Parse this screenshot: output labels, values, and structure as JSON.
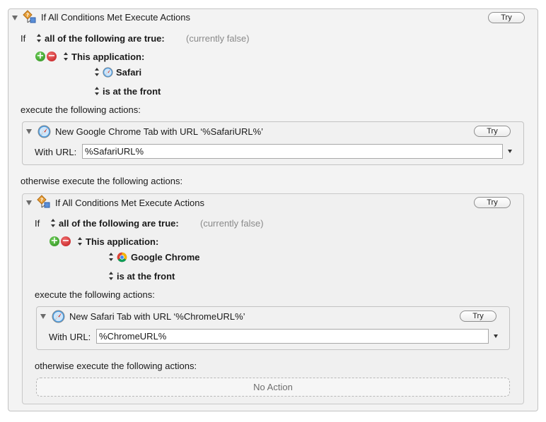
{
  "outer": {
    "title": "If All Conditions Met Execute Actions",
    "try_label": "Try",
    "if_label": "If",
    "condition_mode": "all of the following are true:",
    "condition_state": "(currently false)",
    "condition": {
      "type_label": "This application:",
      "app_name": "Safari",
      "state_label": "is at the front"
    },
    "execute_label": "execute the following actions:",
    "action": {
      "title": "New Google Chrome Tab with URL ‘%SafariURL%’",
      "try_label": "Try",
      "url_label": "With URL:",
      "url_value": "%SafariURL%"
    },
    "otherwise_label": "otherwise execute the following actions:"
  },
  "inner": {
    "title": "If All Conditions Met Execute Actions",
    "try_label": "Try",
    "if_label": "If",
    "condition_mode": "all of the following are true:",
    "condition_state": "(currently false)",
    "condition": {
      "type_label": "This application:",
      "app_name": "Google Chrome",
      "state_label": "is at the front"
    },
    "execute_label": "execute the following actions:",
    "action": {
      "title": "New Safari Tab with URL ‘%ChromeURL%’",
      "try_label": "Try",
      "url_label": "With URL:",
      "url_value": "%ChromeURL%"
    },
    "otherwise_label": "otherwise execute the following actions:",
    "no_action_label": "No Action"
  },
  "icons": {
    "if_action": "if-then-else-icon",
    "safari": "safari-compass-icon",
    "chrome": "google-chrome-icon",
    "plus": "add-condition-icon",
    "minus": "remove-condition-icon"
  },
  "colors": {
    "plus_button": "#2d8d1d",
    "minus_button": "#c0171a",
    "panel_border": "#c3c3c3",
    "muted_text": "#8a8a8a"
  }
}
